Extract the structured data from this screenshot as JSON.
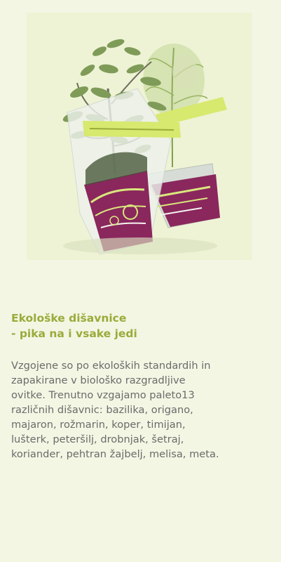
{
  "product": {
    "title_lines": [
      "Ekološke dišavnice",
      "- pika na i vsake jedi"
    ],
    "description_lines": [
      "Vzgojene so po ekoloških standardih in",
      "zapakirane v biološko razgradljive",
      "ovitke. Trenutno vzgajamo paleto13",
      "različnih dišavnic: bazilika, origano,",
      "majaron, rožmarin, koper, timijan,",
      "lušterk, peteršilj, drobnjak, šetraj,",
      "koriander, pehtran žajbelj, melisa, meta."
    ],
    "image_icon": "potted-herbs-photo",
    "colors": {
      "accent": "#9aab3a",
      "text": "#6b6b6b",
      "background": "#f3f6e3"
    }
  }
}
